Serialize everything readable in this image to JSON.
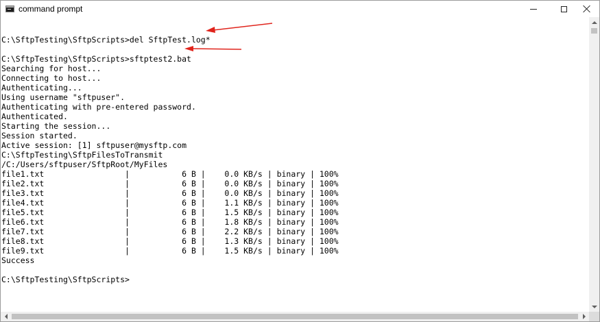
{
  "window": {
    "title": "command prompt",
    "icon": "console-app-icon"
  },
  "controls": {
    "minimize": "minimize-icon",
    "maximize": "maximize-icon",
    "close": "close-icon"
  },
  "console": {
    "lines": [
      "",
      "C:\\SftpTesting\\SftpScripts>del SftpTest.log*",
      "",
      "C:\\SftpTesting\\SftpScripts>sftptest2.bat",
      "Searching for host...",
      "Connecting to host...",
      "Authenticating...",
      "Using username \"sftpuser\".",
      "Authenticating with pre-entered password.",
      "Authenticated.",
      "Starting the session...",
      "Session started.",
      "Active session: [1] sftpuser@mysftp.com",
      "C:\\SftpTesting\\SftpFilesToTransmit",
      "/C:/Users/sftpuser/SftpRoot/MyFiles",
      "file1.txt                 |           6 B |    0.0 KB/s | binary | 100%",
      "file2.txt                 |           6 B |    0.0 KB/s | binary | 100%",
      "file3.txt                 |           6 B |    0.0 KB/s | binary | 100%",
      "file4.txt                 |           6 B |    1.1 KB/s | binary | 100%",
      "file5.txt                 |           6 B |    1.5 KB/s | binary | 100%",
      "file6.txt                 |           6 B |    1.8 KB/s | binary | 100%",
      "file7.txt                 |           6 B |    2.2 KB/s | binary | 100%",
      "file8.txt                 |           6 B |    1.3 KB/s | binary | 100%",
      "file9.txt                 |           6 B |    1.5 KB/s | binary | 100%",
      "Success",
      "",
      "C:\\SftpTesting\\SftpScripts>"
    ]
  },
  "annotations": {
    "arrow_color": "#e0241c"
  }
}
